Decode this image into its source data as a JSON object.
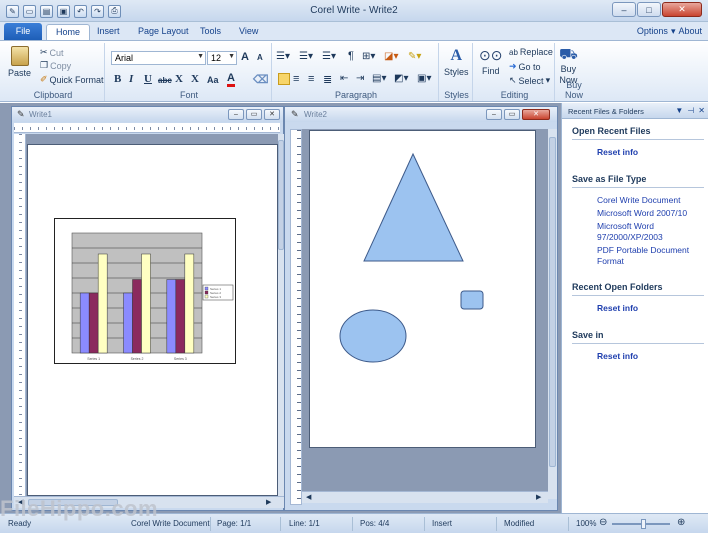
{
  "app": {
    "title": "Corel Write - Write2"
  },
  "quick_access": [
    "save-icon",
    "open-icon",
    "undo-icon",
    "redo-icon",
    "print-icon"
  ],
  "tabs": [
    {
      "label": "File"
    },
    {
      "label": "Home"
    },
    {
      "label": "Insert"
    },
    {
      "label": "Page Layout"
    },
    {
      "label": "Tools"
    },
    {
      "label": "View"
    }
  ],
  "help": {
    "options": "Options",
    "about": "About"
  },
  "ribbon": {
    "clipboard": {
      "label": "Clipboard",
      "paste": "Paste",
      "cut": "Cut",
      "copy": "Copy",
      "quick_format": "Quick Format"
    },
    "font": {
      "label": "Font",
      "family": "Arial",
      "size": "12",
      "grow": "A",
      "shrink": "A",
      "bold": "B",
      "italic": "I",
      "underline": "U",
      "strike": "abc",
      "subscript": "X",
      "superscript": "X",
      "change_case": "Aa",
      "color_a": "A"
    },
    "paragraph": {
      "label": "Paragraph",
      "pilcrow": "¶"
    },
    "styles": {
      "label": "Styles",
      "styles": "Styles"
    },
    "editing": {
      "label": "Editing",
      "find": "Find",
      "replace": "Replace",
      "goto": "Go to",
      "select": "Select"
    },
    "buynow": {
      "label": "Buy Now",
      "buy": "Buy",
      "now": "Now"
    }
  },
  "doc1": {
    "title": "Write1",
    "chart_data": {
      "type": "bar",
      "categories": [
        "Series 1",
        "Series 2",
        "Series 3"
      ],
      "series": [
        {
          "name": "Series 1",
          "color": "#8b8bff",
          "values": [
            4,
            4,
            4.9
          ]
        },
        {
          "name": "Series 2",
          "color": "#8b2a5e",
          "values": [
            4,
            4.9,
            4.9
          ]
        },
        {
          "name": "Series 3",
          "color": "#ffffc2",
          "values": [
            6.6,
            6.6,
            6.6
          ]
        }
      ],
      "ylim": [
        0,
        8
      ],
      "grid": true,
      "legend": "right"
    }
  },
  "doc2": {
    "title": "Write2"
  },
  "panel": {
    "title": "Recent Files & Folders",
    "sections": [
      {
        "heading": "Open Recent Files",
        "items": [
          {
            "text": "Reset info",
            "bold": true
          }
        ]
      },
      {
        "heading": "Save as File Type",
        "items": [
          {
            "text": "Corel Write Document",
            "bold": false
          },
          {
            "text": "Microsoft Word 2007/10",
            "bold": false
          },
          {
            "text": "Microsoft Word 97/2000/XP/2003",
            "bold": false
          },
          {
            "text": "PDF Portable Document Format",
            "bold": false
          }
        ]
      },
      {
        "heading": "Recent Open Folders",
        "items": [
          {
            "text": "Reset info",
            "bold": true
          }
        ]
      },
      {
        "heading": "Save in",
        "items": [
          {
            "text": "Reset info",
            "bold": true
          }
        ]
      }
    ]
  },
  "status": {
    "ready": "Ready",
    "doc_type": "Corel Write Document",
    "page": "Page: 1/1",
    "line": "Line: 1/1",
    "pos": "Pos: 4/4",
    "insert": "Insert",
    "modified": "Modified",
    "zoom": "100%"
  },
  "watermark": "FileHippo.com",
  "colors": {
    "shape_fill": "#9cc3f0",
    "shape_stroke": "#3d5a8a",
    "chart_plot": "#c0c0c0"
  }
}
